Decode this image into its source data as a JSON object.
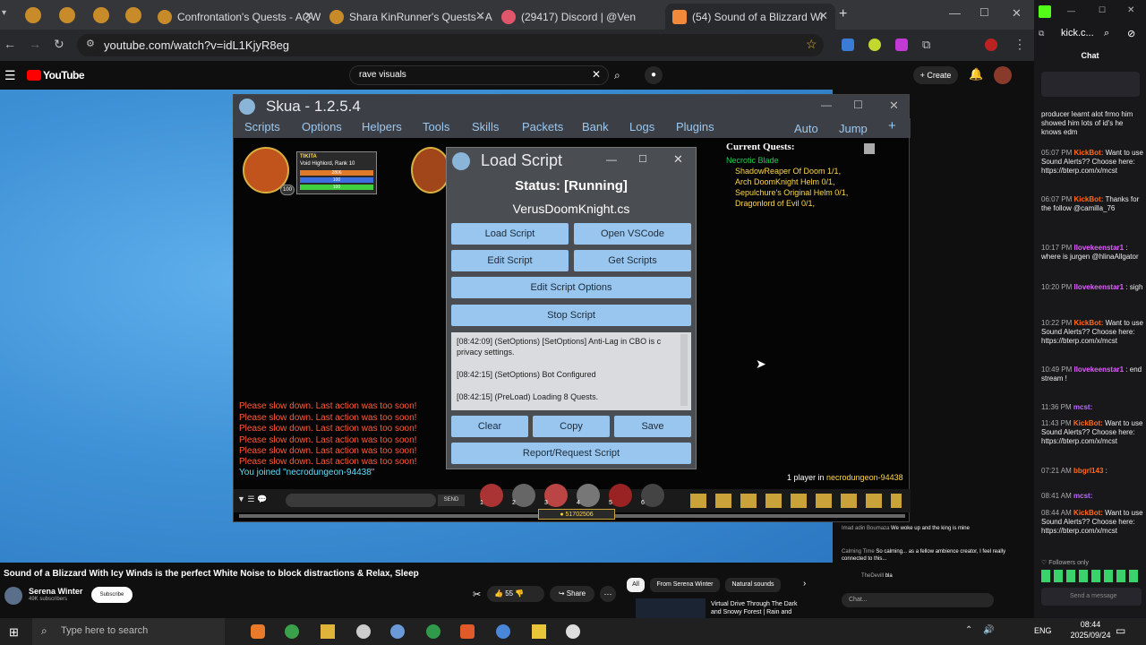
{
  "browser": {
    "tabs": [
      {
        "label": "Confrontation's Quests - AQW"
      },
      {
        "label": "Shara KinRunner's Quests - AQ"
      },
      {
        "label": "(29417) Discord | @Ven"
      },
      {
        "label": "(54) Sound of a Blizzard Wi"
      }
    ],
    "url": "youtube.com/watch?v=idL1KjyR8eg"
  },
  "youtube": {
    "logo": "YouTube",
    "search_value": "rave visuals",
    "create_label": "Create",
    "video_title": "Sound of a Blizzard With Icy Winds is the perfect White Noise to block distractions & Relax, Sleep",
    "channel": "Serena Winter",
    "subs": "49K subscribers",
    "subscribe": "Subscribe",
    "likes": "55",
    "share": "Share",
    "chips": [
      "All",
      "From Serena Winter",
      "Natural sounds"
    ],
    "suggested_title": "Virtual Drive Through The Dark and Snowy Forest | Rain and"
  },
  "skua": {
    "title": "Skua - 1.2.5.4",
    "menu": [
      "Scripts",
      "Options",
      "Helpers",
      "Tools",
      "Skills",
      "Packets",
      "Bank",
      "Logs",
      "Plugins"
    ],
    "auto": "Auto",
    "jump": "Jump",
    "player_name": "TIKITA",
    "player_class": "Void Highlord, Rank 10",
    "hp": "2806",
    "mp": "100",
    "sp": "100",
    "level": "100",
    "quests_heading": "Current Quests:",
    "quest_group": "Necrotic Blade",
    "quests": [
      "ShadowReaper Of Doom 1/1,",
      "Arch DoomKnight Helm 0/1,",
      "Sepulchure's Original Helm 0/1,",
      "Dragonlord of Evil 0/1,"
    ],
    "chat_lines": [
      "Please slow down. Last action was too soon!",
      "Please slow down. Last action was too soon!",
      "Please slow down. Last action was too soon!",
      "Please slow down. Last action was too soon!",
      "Please slow down. Last action was too soon!",
      "Please slow down. Last action was too soon!"
    ],
    "joined": "You joined \"necrodungeon-94438\"",
    "players_prefix": "1 player in ",
    "room": "necrodungeon-94438",
    "send": "SEND",
    "gold": "51702506",
    "hotbar": [
      "1",
      "2",
      "3",
      "4",
      "5",
      "6"
    ]
  },
  "load_script": {
    "title": "Load Script",
    "status": "Status: [Running]",
    "script_name": "VerusDoomKnight.cs",
    "buttons": {
      "load": "Load Script",
      "open_vscode": "Open VSCode",
      "edit": "Edit Script",
      "get": "Get Scripts",
      "edit_options": "Edit Script Options",
      "stop": "Stop Script",
      "clear": "Clear",
      "copy": "Copy",
      "save": "Save",
      "report": "Report/Request Script"
    },
    "log": [
      "[08:42:09] (SetOptions)  [SetOptions] Anti-Lag in CBO is c privacy settings.",
      "[08:42:15] (SetOptions)  Bot Configured",
      "[08:42:15] (PreLoad)  Loading 8 Quests."
    ]
  },
  "twitch": {
    "url": "kick.c...",
    "chat_title": "Chat",
    "messages": [
      {
        "user": "",
        "text": "producer learnt alot frmo him showed him lots of id's he knows edm"
      },
      {
        "time": "05:07 PM",
        "user": "KickBot:",
        "text": "Want to use Sound Alerts?? Choose here: https://bterp.com/x/mcst"
      },
      {
        "time": "06:07 PM",
        "user": "KickBot:",
        "text": "Thanks for the follow @camilla_76"
      },
      {
        "time": "10:17 PM",
        "user": "llovekeenstar1",
        "text": ": where is jurgen @hlinaAllgator"
      },
      {
        "time": "10:20 PM",
        "user": "llovekeenstar1",
        "text": ": sigh"
      },
      {
        "time": "10:22 PM",
        "user": "KickBot:",
        "text": "Want to use Sound Alerts?? Choose here: https://bterp.com/x/mcst"
      },
      {
        "time": "10:49 PM",
        "user": "llovekeenstar1",
        "text": ": end stream !"
      },
      {
        "time": "11:36 PM",
        "user": "mcst:",
        "text": ""
      },
      {
        "time": "11:43 PM",
        "user": "KickBot:",
        "text": "Want to use Sound Alerts?? Choose here: https://bterp.com/x/mcst"
      },
      {
        "time": "07:21 AM",
        "user": "bbgrl143",
        "text": ":"
      },
      {
        "time": "08:41 AM",
        "user": "mcst:",
        "text": ""
      },
      {
        "time": "08:44 AM",
        "user": "KickBot:",
        "text": "Want to use Sound Alerts?? Choose here: https://bterp.com/x/mcst"
      }
    ],
    "followers_only": "Followers only",
    "send_placeholder": "Send a message"
  },
  "overlay_chat": [
    {
      "user": "Imad adin Boumaza",
      "text": "We woke up and the king is mine"
    },
    {
      "user": "Calming Time",
      "text": "So calming... as a fellow ambience creator, I feel really connected to this..."
    },
    {
      "user": "TheDevill",
      "text": "bla"
    }
  ],
  "overlay_chat_placeholder": "Chat...",
  "taskbar": {
    "search_placeholder": "Type here to search",
    "lang": "ENG",
    "time": "08:44",
    "date": "2025/09/24"
  },
  "colors": {
    "accent": "#98c6ee",
    "warn": "#ff5b3a",
    "quest": "#ffd84a",
    "link": "#1fd14c"
  }
}
